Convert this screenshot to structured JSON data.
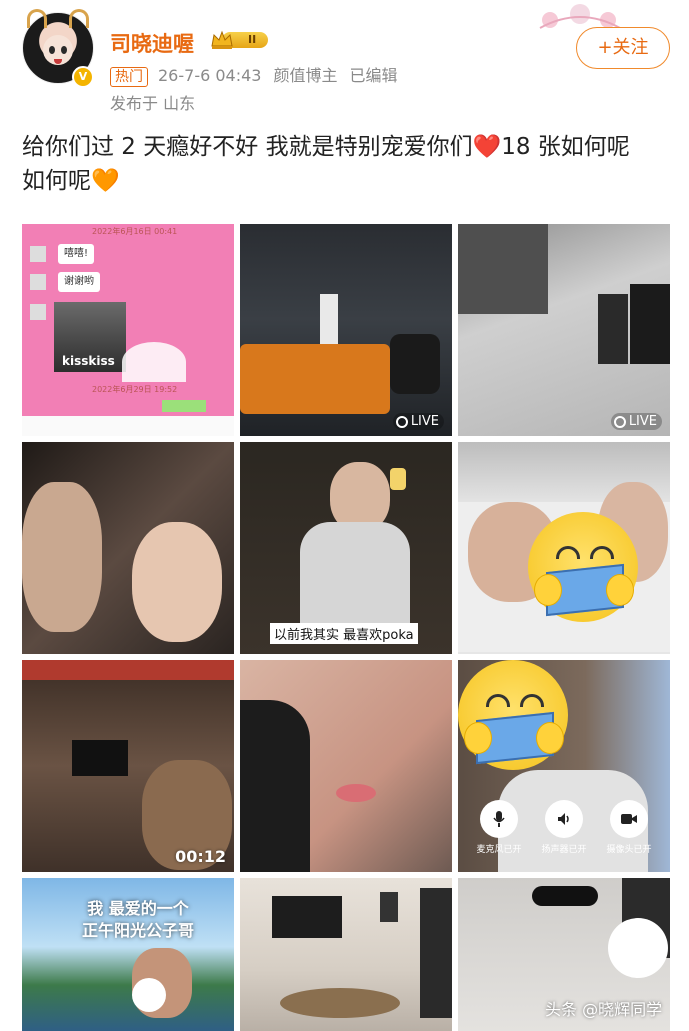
{
  "user": {
    "name": "司晓迪喔",
    "level_badge": "II",
    "verified": "V",
    "avatar_icon": "anime-girl-avatar-icon"
  },
  "meta": {
    "tag": "热门",
    "datetime": "26-7-6 04:43",
    "title": "颜值博主",
    "edited": "已编辑",
    "location": "发布于 山东"
  },
  "follow_button": "+关注",
  "post": {
    "text_part1": "给你们过 2 天瘾好不好 我就是特别宠爱你们",
    "heart_red": "❤️",
    "text_part2": "18 张如何呢",
    "text_part3": "如何呢",
    "heart_orange": "🧡"
  },
  "grid": {
    "cell1": {
      "chat_time_top": "2022年6月16日 00:41",
      "bubble1": "嘻嘻!",
      "bubble2": "谢谢哟",
      "sticker_text": "kisskiss",
      "chat_time_bottom": "2022年6月29日 19:52"
    },
    "cell2": {
      "live": "LIVE"
    },
    "cell3": {
      "live": "LIVE"
    },
    "cell5": {
      "subtitle": "以前我其实 最喜欢poka"
    },
    "cell7": {
      "duration": "00:12"
    },
    "cell9": {
      "mic_label": "麦克风已开",
      "speaker_label": "扬声器已开",
      "camera_label": "摄像头已开"
    },
    "cell10": {
      "caption_line1": "我 最爱的一个",
      "caption_line2": "正午阳光公子哥"
    }
  },
  "watermark": "头条 @晓辉同学",
  "colors": {
    "username": "#e86a12",
    "meta_gray": "#8a8a8a",
    "follow_border": "#f08a2c"
  }
}
